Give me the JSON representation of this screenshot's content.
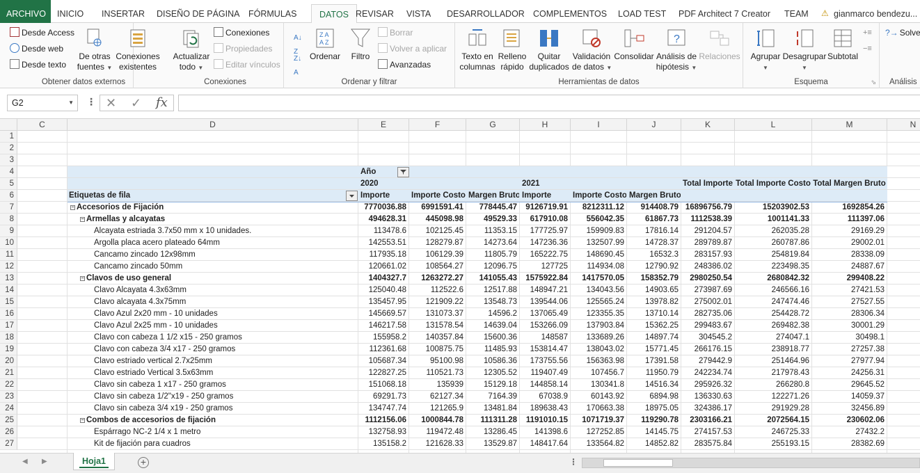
{
  "ribbon_tabs": [
    "ARCHIVO",
    "INICIO",
    "INSERTAR",
    "DISEÑO DE PÁGINA",
    "FÓRMULAS",
    "DATOS",
    "REVISAR",
    "VISTA",
    "DESARROLLADOR",
    "COMPLEMENTOS",
    "LOAD TEST",
    "PDF Architect 7 Creator",
    "TEAM"
  ],
  "active_tab": "DATOS",
  "account": "gianmarco bendezu...",
  "groups": {
    "external": {
      "label": "Obtener datos externos",
      "from_access": "Desde Access",
      "from_web": "Desde web",
      "from_text": "Desde texto",
      "other_sources": "De otras fuentes",
      "existing_connections": "Conexiones existentes"
    },
    "connections": {
      "label": "Conexiones",
      "refresh_all": "Actualizar todo",
      "connections": "Conexiones",
      "properties": "Propiedades",
      "edit_links": "Editar vínculos"
    },
    "sort_filter": {
      "label": "Ordenar y filtrar",
      "sort": "Ordenar",
      "filter": "Filtro",
      "clear": "Borrar",
      "reapply": "Volver a aplicar",
      "advanced": "Avanzadas"
    },
    "data_tools": {
      "label": "Herramientas de datos",
      "text_to_columns": "Texto en columnas",
      "flash_fill": "Relleno rápido",
      "remove_duplicates": "Quitar duplicados",
      "data_validation": "Validación de datos",
      "consolidate": "Consolidar",
      "what_if": "Análisis de hipótesis",
      "relationships": "Relaciones"
    },
    "outline": {
      "label": "Esquema",
      "group": "Agrupar",
      "ungroup": "Desagrupar",
      "subtotal": "Subtotal"
    },
    "analysis": {
      "label": "Análisis",
      "solver": "Solver"
    }
  },
  "name_box": "G2",
  "formula_content": "",
  "columns": [
    "C",
    "D",
    "E",
    "F",
    "G",
    "H",
    "I",
    "J",
    "K",
    "L",
    "M",
    "N"
  ],
  "pivot": {
    "year_label": "Año",
    "year_2020": "2020",
    "year_2021": "2021",
    "row_labels": "Etiquetas de fila",
    "headers": [
      "Importe",
      "Importe Costo",
      "Margen Bruto",
      "Importe",
      "Importe Costo",
      "Margen Bruto",
      "Total Importe",
      "Total Importe Costo",
      "Total Margen Bruto"
    ],
    "rows": [
      {
        "r": "7",
        "level": 0,
        "toggle": true,
        "label": "Accesorios de Fijación",
        "vals": [
          "7770036.88",
          "6991591.41",
          "778445.47",
          "9126719.91",
          "8212311.12",
          "914408.79",
          "16896756.79",
          "15203902.53",
          "1692854.26"
        ]
      },
      {
        "r": "8",
        "level": 1,
        "toggle": true,
        "label": "Armellas y alcayatas",
        "vals": [
          "494628.31",
          "445098.98",
          "49529.33",
          "617910.08",
          "556042.35",
          "61867.73",
          "1112538.39",
          "1001141.33",
          "111397.06"
        ]
      },
      {
        "r": "9",
        "level": 2,
        "toggle": false,
        "label": "Alcayata estriada 3.7x50 mm x 10 unidades.",
        "vals": [
          "113478.6",
          "102125.45",
          "11353.15",
          "177725.97",
          "159909.83",
          "17816.14",
          "291204.57",
          "262035.28",
          "29169.29"
        ]
      },
      {
        "r": "10",
        "level": 2,
        "toggle": false,
        "label": "Argolla placa acero plateado 64mm",
        "vals": [
          "142553.51",
          "128279.87",
          "14273.64",
          "147236.36",
          "132507.99",
          "14728.37",
          "289789.87",
          "260787.86",
          "29002.01"
        ]
      },
      {
        "r": "11",
        "level": 2,
        "toggle": false,
        "label": "Cancamo zincado 12x98mm",
        "vals": [
          "117935.18",
          "106129.39",
          "11805.79",
          "165222.75",
          "148690.45",
          "16532.3",
          "283157.93",
          "254819.84",
          "28338.09"
        ]
      },
      {
        "r": "12",
        "level": 2,
        "toggle": false,
        "label": "Cancamo zincado 50mm",
        "vals": [
          "120661.02",
          "108564.27",
          "12096.75",
          "127725",
          "114934.08",
          "12790.92",
          "248386.02",
          "223498.35",
          "24887.67"
        ]
      },
      {
        "r": "13",
        "level": 1,
        "toggle": true,
        "label": "Clavos de uso general",
        "vals": [
          "1404327.7",
          "1263272.27",
          "141055.43",
          "1575922.84",
          "1417570.05",
          "158352.79",
          "2980250.54",
          "2680842.32",
          "299408.22"
        ]
      },
      {
        "r": "14",
        "level": 2,
        "toggle": false,
        "label": "Clavo Alcayata 4.3x63mm",
        "vals": [
          "125040.48",
          "112522.6",
          "12517.88",
          "148947.21",
          "134043.56",
          "14903.65",
          "273987.69",
          "246566.16",
          "27421.53"
        ]
      },
      {
        "r": "15",
        "level": 2,
        "toggle": false,
        "label": "Clavo alcayata 4.3x75mm",
        "vals": [
          "135457.95",
          "121909.22",
          "13548.73",
          "139544.06",
          "125565.24",
          "13978.82",
          "275002.01",
          "247474.46",
          "27527.55"
        ]
      },
      {
        "r": "16",
        "level": 2,
        "toggle": false,
        "label": "Clavo Azul 2x20 mm - 10 unidades",
        "vals": [
          "145669.57",
          "131073.37",
          "14596.2",
          "137065.49",
          "123355.35",
          "13710.14",
          "282735.06",
          "254428.72",
          "28306.34"
        ]
      },
      {
        "r": "17",
        "level": 2,
        "toggle": false,
        "label": "Clavo Azul 2x25 mm - 10 unidades",
        "vals": [
          "146217.58",
          "131578.54",
          "14639.04",
          "153266.09",
          "137903.84",
          "15362.25",
          "299483.67",
          "269482.38",
          "30001.29"
        ]
      },
      {
        "r": "18",
        "level": 2,
        "toggle": false,
        "label": "Clavo con cabeza 1 1/2 x15 - 250 gramos",
        "vals": [
          "155958.2",
          "140357.84",
          "15600.36",
          "148587",
          "133689.26",
          "14897.74",
          "304545.2",
          "274047.1",
          "30498.1"
        ]
      },
      {
        "r": "19",
        "level": 2,
        "toggle": false,
        "label": "Clavo con cabeza 3/4 x17 - 250 gramos",
        "vals": [
          "112361.68",
          "100875.75",
          "11485.93",
          "153814.47",
          "138043.02",
          "15771.45",
          "266176.15",
          "238918.77",
          "27257.38"
        ]
      },
      {
        "r": "20",
        "level": 2,
        "toggle": false,
        "label": "Clavo estriado vertical 2.7x25mm",
        "vals": [
          "105687.34",
          "95100.98",
          "10586.36",
          "173755.56",
          "156363.98",
          "17391.58",
          "279442.9",
          "251464.96",
          "27977.94"
        ]
      },
      {
        "r": "21",
        "level": 2,
        "toggle": false,
        "label": "Clavo estriado Vertical 3.5x63mm",
        "vals": [
          "122827.25",
          "110521.73",
          "12305.52",
          "119407.49",
          "107456.7",
          "11950.79",
          "242234.74",
          "217978.43",
          "24256.31"
        ]
      },
      {
        "r": "22",
        "level": 2,
        "toggle": false,
        "label": "Clavo sin cabeza 1 x17 - 250 gramos",
        "vals": [
          "151068.18",
          "135939",
          "15129.18",
          "144858.14",
          "130341.8",
          "14516.34",
          "295926.32",
          "266280.8",
          "29645.52"
        ]
      },
      {
        "r": "23",
        "level": 2,
        "toggle": false,
        "label": "Clavo sin cabeza 1/2\"x19 - 250 gramos",
        "vals": [
          "69291.73",
          "62127.34",
          "7164.39",
          "67038.9",
          "60143.92",
          "6894.98",
          "136330.63",
          "122271.26",
          "14059.37"
        ]
      },
      {
        "r": "24",
        "level": 2,
        "toggle": false,
        "label": "Clavo sin cabeza 3/4 x19 - 250 gramos",
        "vals": [
          "134747.74",
          "121265.9",
          "13481.84",
          "189638.43",
          "170663.38",
          "18975.05",
          "324386.17",
          "291929.28",
          "32456.89"
        ]
      },
      {
        "r": "25",
        "level": 1,
        "toggle": true,
        "label": "Combos de accesorios de fijación",
        "vals": [
          "1112156.06",
          "1000844.78",
          "111311.28",
          "1191010.15",
          "1071719.37",
          "119290.78",
          "2303166.21",
          "2072564.15",
          "230602.06"
        ]
      },
      {
        "r": "26",
        "level": 2,
        "toggle": false,
        "label": "Espárrago NC-2 1/4 x 1 metro",
        "vals": [
          "132758.93",
          "119472.48",
          "13286.45",
          "141398.6",
          "127252.85",
          "14145.75",
          "274157.53",
          "246725.33",
          "27432.2"
        ]
      },
      {
        "r": "27",
        "level": 2,
        "toggle": false,
        "label": "Kit de fijación para cuadros",
        "vals": [
          "135158.2",
          "121628.33",
          "13529.87",
          "148417.64",
          "133564.82",
          "14852.82",
          "283575.84",
          "255193.15",
          "28382.69"
        ]
      }
    ]
  },
  "sheet_tab": "Hoja1",
  "colors": {
    "excel_green": "#217346",
    "pivot_header": "#ddebf7",
    "pivot_line": "#8db4e2"
  }
}
